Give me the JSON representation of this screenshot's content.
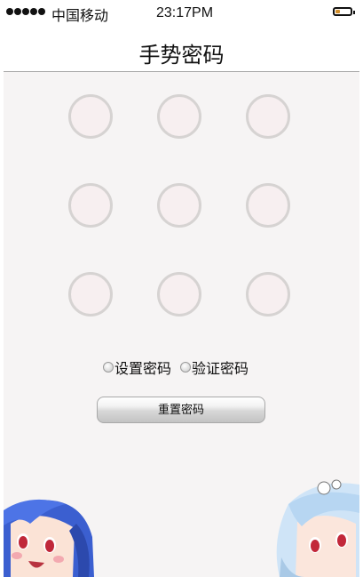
{
  "status_bar": {
    "carrier": "中国移动",
    "time": "23:17PM",
    "signal_strength": 5,
    "battery_level": 0.35
  },
  "nav": {
    "title": "手势密码"
  },
  "gesture_grid": {
    "rows": 3,
    "cols": 3,
    "node_count": 9
  },
  "modes": [
    {
      "label": "设置密码"
    },
    {
      "label": "验证密码"
    }
  ],
  "reset_button": {
    "label": "重置密码"
  },
  "colors": {
    "node_border": "#d6d3d2",
    "node_fill": "#f7eff0",
    "background": "#f6f4f4",
    "battery_fill": "#d28e2a"
  }
}
